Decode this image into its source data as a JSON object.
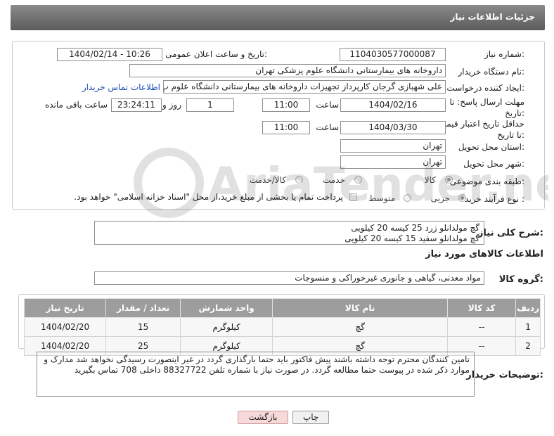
{
  "header": {
    "title": "جزئیات اطلاعات نیاز"
  },
  "form": {
    "need_number_label": "شماره نیاز:",
    "need_number": "1104030577000087",
    "announce_label": "تاریخ و ساعت اعلان عمومی:",
    "announce_value": "1404/02/14 - 10:26",
    "buyer_org_label": "نام دستگاه خریدار:",
    "buyer_org": "داروخانه های بیمارستانی دانشگاه علوم پزشکی تهران",
    "requester_label": "ایجاد کننده درخواست:",
    "requester": "علی شهبازی گرجان کارپرداز تجهیزات داروخانه های بیمارستانی دانشگاه علوم پ",
    "contact_link": "اطلاعات تماس خریدار",
    "deadline_label": "مهلت ارسال پاسخ: تا تاریخ:",
    "deadline_date": "1404/02/16",
    "time_label": "ساعت",
    "deadline_time": "11:00",
    "days_value": "1",
    "days_label": "روز و",
    "remaining_time": "23:24:11",
    "remaining_label": "ساعت باقی مانده",
    "min_validity_label": "حداقل تاریخ اعتبار قیمت: تا تاریخ:",
    "min_validity_date": "1404/03/30",
    "min_validity_time": "11:00",
    "province_label": "استان محل تحویل:",
    "province": "تهران",
    "city_label": "شهر محل تحویل:",
    "city": "تهران",
    "category_label": "طبقه بندی موضوعی:",
    "category_options": [
      "کالا",
      "خدمت",
      "کالا/خدمت"
    ],
    "process_label": "نوع فرآیند خرید :",
    "process_options": [
      "جزیی",
      "متوسط"
    ],
    "payment_note": "پرداخت تمام یا بخشی از مبلغ خرید،از محل \"اسناد خزانه اسلامی\" خواهد بود."
  },
  "description": {
    "label": "شرح کلی نیاز:",
    "line1": "گچ مولدانلو زرد 25 کیسه 20 کیلویی",
    "line2": "گچ مولدانلو سفید 15 کیسه 20 کیلویی"
  },
  "goods": {
    "section_title": "اطلاعات کالاهای مورد نیاز",
    "group_label": "گروه کالا:",
    "group_value": "مواد معدنی، گیاهی و جانوری غیرخوراکی و منسوجات"
  },
  "table": {
    "headers": [
      "ردیف",
      "کد کالا",
      "نام کالا",
      "واحد شمارش",
      "تعداد / مقدار",
      "تاریخ نیاز"
    ],
    "rows": [
      [
        "1",
        "--",
        "گچ",
        "کیلوگرم",
        "15",
        "1404/02/20"
      ],
      [
        "2",
        "--",
        "گچ",
        "کیلوگرم",
        "25",
        "1404/02/20"
      ]
    ]
  },
  "notes": {
    "label": "توضیحات خریدار:",
    "text": "تامین کنندگان محترم توجه داشته باشند پیش فاکتور باید حتما بارگذاری گردد در غیر اینصورت رسیدگی نخواهد شد مدارک و موارد ذکر شده در پیوست حتما مطالعه گردد. در صورت نیاز با شماره تلفن 88327722 داخلی 708 تماس بگیرید"
  },
  "buttons": {
    "print": "چاپ",
    "back": "بازگشت"
  },
  "watermark": {
    "text": "AriaTender.neT"
  },
  "colors": {
    "header": "#6e6e6e",
    "table_header": "#9d9d9d",
    "link": "#1a4fb8",
    "back_button": "#f7d9d9"
  }
}
